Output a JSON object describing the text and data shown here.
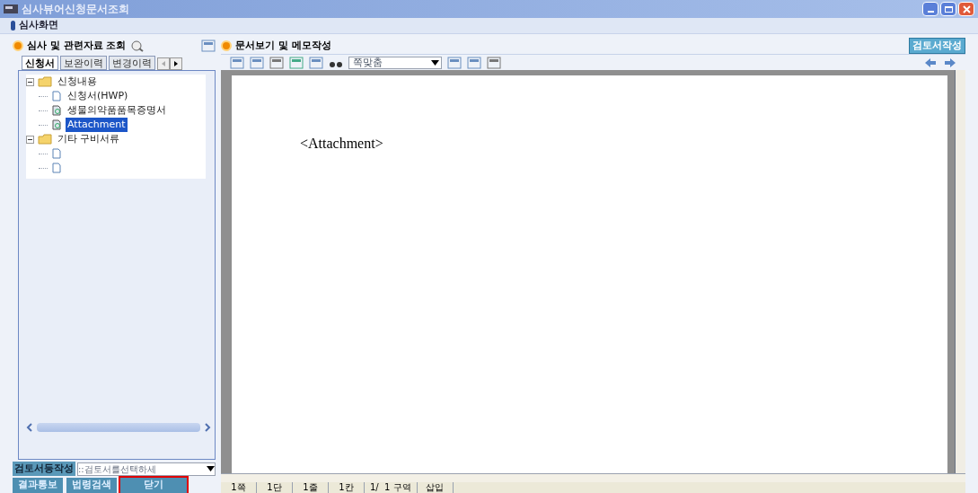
{
  "window": {
    "title": "심사뷰어신청문서조회"
  },
  "subheader": "심사화면",
  "left_panel": {
    "title": "심사 및 관련자료 조회",
    "tabs": [
      {
        "label": "신청서",
        "selected": true
      },
      {
        "label": "보완이력",
        "selected": false
      },
      {
        "label": "변경이력",
        "selected": false
      }
    ],
    "tree": [
      {
        "label": "신청내용",
        "kind": "folder",
        "expanded": true,
        "children": [
          {
            "label": "신청서(HWP)",
            "kind": "doc",
            "selected": false
          },
          {
            "label": "생물의약품품목증명서",
            "kind": "attach",
            "selected": false
          },
          {
            "label": "Attachment",
            "kind": "attach",
            "selected": true
          }
        ]
      },
      {
        "label": "기타 구비서류",
        "kind": "folder",
        "expanded": true,
        "children": [
          {
            "kind": "doc",
            "selected": false
          },
          {
            "kind": "doc",
            "selected": false
          }
        ]
      }
    ],
    "review_label": "검토서등작성",
    "review_select": "::검토서를선택하세",
    "buttons": [
      {
        "label": "결과통보",
        "highlighted": false
      },
      {
        "label": "법령검색",
        "highlighted": false
      },
      {
        "label": "닫기",
        "highlighted": true
      }
    ]
  },
  "right_panel": {
    "title": "문서보기 및 메모작성",
    "action_button": "검토서작성",
    "zoom_select": "쪽맞춤",
    "document_text": "<Attachment>",
    "status_bar": [
      "1쪽",
      "1단",
      "1줄",
      "1칸",
      "1/  1 구역",
      "삽입"
    ]
  }
}
